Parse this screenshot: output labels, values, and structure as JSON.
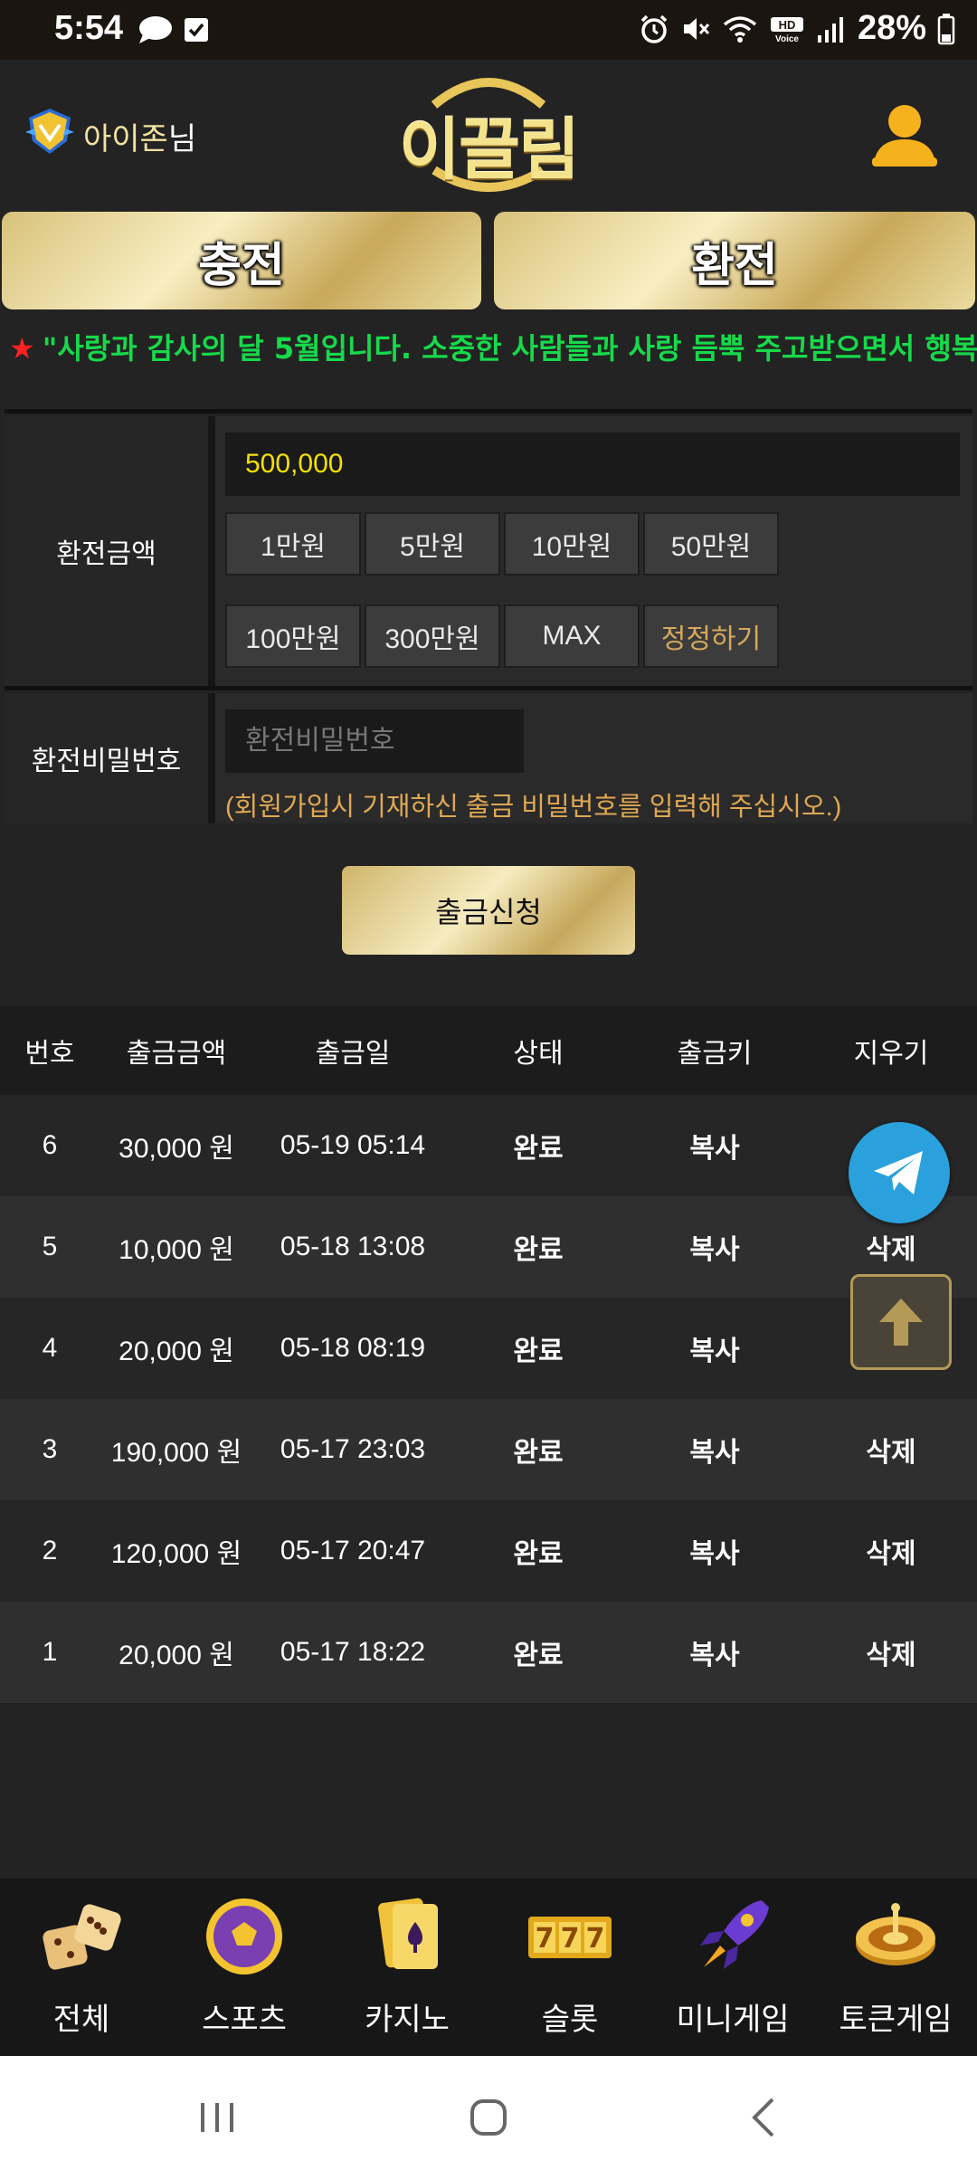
{
  "status_bar": {
    "time": "5:54",
    "battery": "28%",
    "icons": [
      "chat-bubble-icon",
      "checkbox-icon",
      "alarm-icon",
      "mute-icon",
      "wifi-icon",
      "hd-voice-icon",
      "signal-icon",
      "battery-icon"
    ]
  },
  "header": {
    "user_name": "아이존",
    "user_suffix": "님",
    "logo_text": "이끌림"
  },
  "tabs": {
    "charge": "충전",
    "exchange": "환전"
  },
  "notice": {
    "text": "\"사랑과 감사의 달 5월입니다. 소중한 사람들과 사랑 듬뿍 주고받으면서 행복"
  },
  "form": {
    "amount_label": "환전금액",
    "amount_value": "500,000",
    "chips": [
      "1만원",
      "5만원",
      "10만원",
      "50만원",
      "100만원",
      "300만원",
      "MAX",
      "정정하기"
    ],
    "password_label": "환전비밀번호",
    "password_placeholder": "환전비밀번호",
    "password_note": "(회원가입시 기재하신 출금 비밀번호를 입력해 주십시오.)",
    "submit": "출금신청"
  },
  "table": {
    "headers": [
      "번호",
      "출금금액",
      "출금일",
      "상태",
      "출금키",
      "지우기"
    ],
    "rows": [
      {
        "no": "6",
        "amount": "30,000 원",
        "date": "05-19 05:14",
        "status": "완료",
        "key": "복사",
        "delete": ""
      },
      {
        "no": "5",
        "amount": "10,000 원",
        "date": "05-18 13:08",
        "status": "완료",
        "key": "복사",
        "delete": "삭제"
      },
      {
        "no": "4",
        "amount": "20,000 원",
        "date": "05-18 08:19",
        "status": "완료",
        "key": "복사",
        "delete": ""
      },
      {
        "no": "3",
        "amount": "190,000 원",
        "date": "05-17 23:03",
        "status": "완료",
        "key": "복사",
        "delete": "삭제"
      },
      {
        "no": "2",
        "amount": "120,000 원",
        "date": "05-17 20:47",
        "status": "완료",
        "key": "복사",
        "delete": "삭제"
      },
      {
        "no": "1",
        "amount": "20,000 원",
        "date": "05-17 18:22",
        "status": "완료",
        "key": "복사",
        "delete": "삭제"
      }
    ]
  },
  "bottom_nav": [
    {
      "label": "전체",
      "icon": "dice-icon"
    },
    {
      "label": "스포츠",
      "icon": "soccer-ball-icon"
    },
    {
      "label": "카지노",
      "icon": "cards-icon"
    },
    {
      "label": "슬롯",
      "icon": "slot-777-icon"
    },
    {
      "label": "미니게임",
      "icon": "rocket-icon"
    },
    {
      "label": "토큰게임",
      "icon": "roulette-icon"
    }
  ],
  "colors": {
    "gold": "#e8d89a",
    "notice_green": "#17d94a",
    "amount_yellow": "#f5e000",
    "note_orange": "#e0a854",
    "telegram_blue": "#2aa1dc"
  }
}
